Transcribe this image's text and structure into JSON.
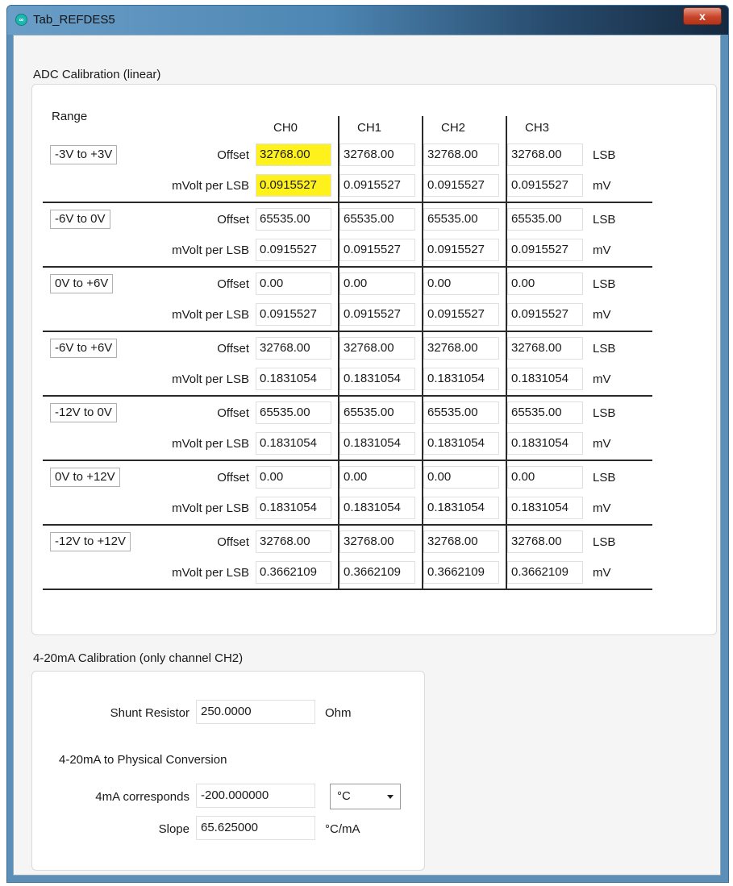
{
  "window": {
    "title": "Tab_REFDES5",
    "close_label": "x",
    "app_icon_glyph": "∞"
  },
  "adc": {
    "group_title": "ADC Calibration (linear)",
    "range_header": "Range",
    "channels": [
      "CH0",
      "CH1",
      "CH2",
      "CH3"
    ],
    "offset_label": "Offset",
    "mvolt_label": "mVolt per LSB",
    "offset_unit": "LSB",
    "mvolt_unit": "mV",
    "highlight_color": "#fff21c",
    "ranges": [
      {
        "label": "-3V to +3V",
        "offset": [
          "32768.00",
          "32768.00",
          "32768.00",
          "32768.00"
        ],
        "mvolt": [
          "0.0915527",
          "0.0915527",
          "0.0915527",
          "0.0915527"
        ]
      },
      {
        "label": "-6V to 0V",
        "offset": [
          "65535.00",
          "65535.00",
          "65535.00",
          "65535.00"
        ],
        "mvolt": [
          "0.0915527",
          "0.0915527",
          "0.0915527",
          "0.0915527"
        ]
      },
      {
        "label": "0V to +6V",
        "offset": [
          "0.00",
          "0.00",
          "0.00",
          "0.00"
        ],
        "mvolt": [
          "0.0915527",
          "0.0915527",
          "0.0915527",
          "0.0915527"
        ]
      },
      {
        "label": "-6V to +6V",
        "offset": [
          "32768.00",
          "32768.00",
          "32768.00",
          "32768.00"
        ],
        "mvolt": [
          "0.1831054",
          "0.1831054",
          "0.1831054",
          "0.1831054"
        ]
      },
      {
        "label": "-12V to 0V",
        "offset": [
          "65535.00",
          "65535.00",
          "65535.00",
          "65535.00"
        ],
        "mvolt": [
          "0.1831054",
          "0.1831054",
          "0.1831054",
          "0.1831054"
        ]
      },
      {
        "label": "0V to +12V",
        "offset": [
          "0.00",
          "0.00",
          "0.00",
          "0.00"
        ],
        "mvolt": [
          "0.1831054",
          "0.1831054",
          "0.1831054",
          "0.1831054"
        ]
      },
      {
        "label": "-12V to +12V",
        "offset": [
          "32768.00",
          "32768.00",
          "32768.00",
          "32768.00"
        ],
        "mvolt": [
          "0.3662109",
          "0.3662109",
          "0.3662109",
          "0.3662109"
        ]
      }
    ]
  },
  "ma": {
    "group_title": "4-20mA Calibration (only channel CH2)",
    "shunt_label": "Shunt Resistor",
    "shunt_value": "250.0000",
    "shunt_unit": "Ohm",
    "conversion_heading": "4-20mA to Physical Conversion",
    "corresponds_label": "4mA corresponds",
    "corresponds_value": "-200.000000",
    "unit_selected": "°C",
    "slope_label": "Slope",
    "slope_value": "65.625000",
    "slope_unit": "°C/mA"
  }
}
